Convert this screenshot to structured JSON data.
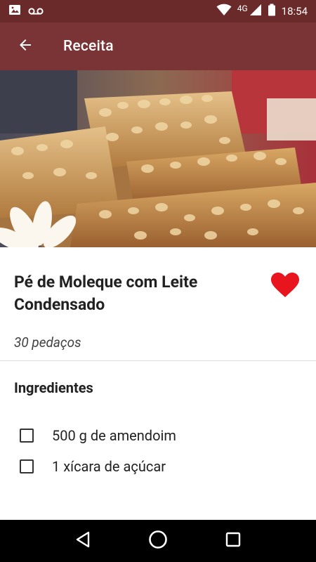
{
  "status_bar": {
    "network": "4G",
    "time": "18:54",
    "icons": [
      "image-icon",
      "voicemail-icon",
      "wifi-icon",
      "signal-icon",
      "battery-icon"
    ]
  },
  "app_bar": {
    "title": "Receita",
    "back_icon": "arrow-back-icon"
  },
  "recipe": {
    "title": "Pé de Moleque com Leite Condensado",
    "yield": "30 pedaços",
    "favorite": true,
    "favorite_color": "#e8141e"
  },
  "ingredients_section": {
    "heading": "Ingredientes",
    "items": [
      {
        "label": "500 g de amendoim",
        "checked": false
      },
      {
        "label": "1 xícara de açúcar",
        "checked": false
      }
    ]
  },
  "nav_bar": {
    "icons": [
      "back-triangle-icon",
      "home-circle-icon",
      "recents-square-icon"
    ]
  },
  "colors": {
    "status_bar": "#6b2a2a",
    "app_bar": "#7a3435",
    "nav_bar": "#000000"
  }
}
